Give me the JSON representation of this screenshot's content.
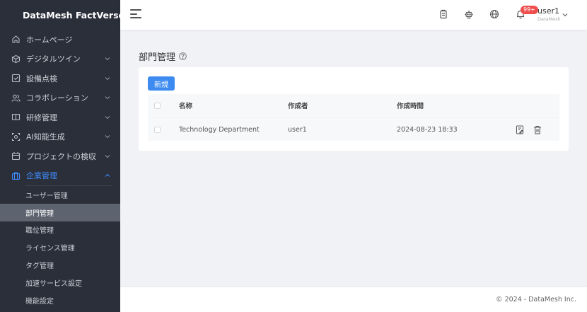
{
  "app": {
    "name": "DataMesh FactVerse"
  },
  "sidebar": {
    "items": [
      {
        "label": "ホームページ",
        "icon": "home-icon"
      },
      {
        "label": "デジタルツイン",
        "icon": "cube-icon"
      },
      {
        "label": "設備点検",
        "icon": "checkbox-icon"
      },
      {
        "label": "コラボレーション",
        "icon": "users-icon"
      },
      {
        "label": "研修管理",
        "icon": "book-icon"
      },
      {
        "label": "AI知能生成",
        "icon": "ai-scan-icon"
      },
      {
        "label": "プロジェクトの検収",
        "icon": "calendar-icon"
      },
      {
        "label": "企業管理",
        "icon": "briefcase-icon"
      }
    ],
    "submenu": [
      "ユーザー管理",
      "部門管理",
      "職位管理",
      "ライセンス管理",
      "タグ管理",
      "加速サービス設定",
      "機能設定"
    ],
    "active_color": "#3f8cff"
  },
  "header": {
    "badge": "99+",
    "user_name": "user1",
    "user_org": "DataMesh"
  },
  "main": {
    "title": "部門管理",
    "new_button": "新規",
    "columns": [
      "名称",
      "作成者",
      "作成時間"
    ],
    "rows": [
      {
        "name": "Technology Department",
        "creator": "user1",
        "created": "2024-08-23 18:33"
      }
    ]
  },
  "footer": {
    "copyright": "© 2024 - DataMesh Inc."
  },
  "colors": {
    "primary": "#3d8bf1",
    "sidebar_bg": "#2b2f3a",
    "badge": "#f04e4e"
  }
}
